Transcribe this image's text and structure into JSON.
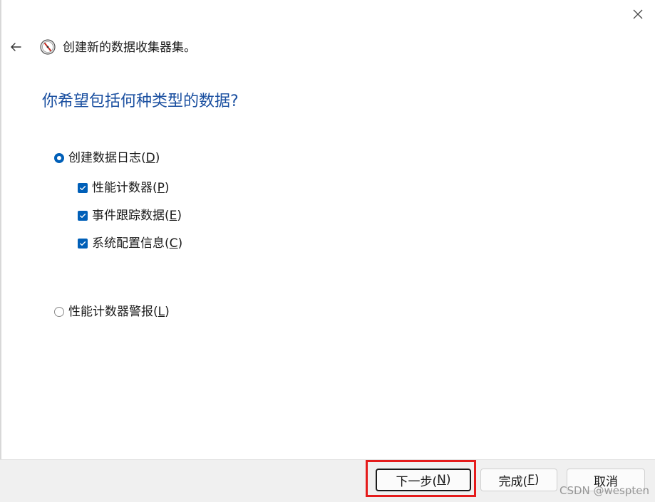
{
  "window": {
    "title": "创建新的数据收集器集。",
    "heading": "你希望包括何种类型的数据?",
    "close_icon": "close-icon",
    "back_icon": "back-arrow-icon",
    "app_icon": "performance-monitor-icon"
  },
  "options": {
    "data_log": {
      "label": "创建数据日志(",
      "key": "D",
      "suffix": ")",
      "selected": true
    },
    "perf_counter": {
      "label": "性能计数器(",
      "key": "P",
      "suffix": ")",
      "checked": true
    },
    "event_trace": {
      "label": "事件跟踪数据(",
      "key": "E",
      "suffix": ")",
      "checked": true
    },
    "sys_config": {
      "label": "系统配置信息(",
      "key": "C",
      "suffix": ")",
      "checked": true
    },
    "perf_alert": {
      "label": "性能计数器警报(",
      "key": "L",
      "suffix": ")",
      "selected": false
    }
  },
  "buttons": {
    "next": {
      "label": "下一步(",
      "key": "N",
      "suffix": ")"
    },
    "finish": {
      "label": "完成(",
      "key": "F",
      "suffix": ")"
    },
    "cancel": {
      "label": "取消"
    }
  },
  "watermark": "CSDN @wespten",
  "colors": {
    "accent": "#005fb8",
    "heading": "#1a4fa0",
    "highlight": "#e51b1b",
    "footer": "#f0f0f0"
  }
}
